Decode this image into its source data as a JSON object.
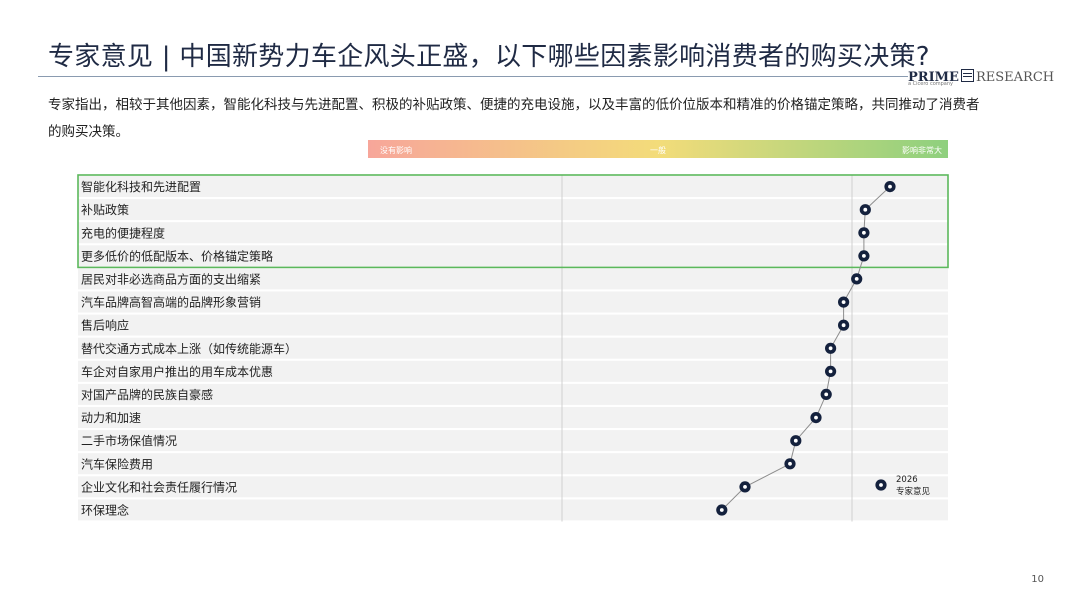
{
  "header": {
    "title": "专家意见 | 中国新势力车企风头正盛，以下哪些因素影响消费者的购买决策?",
    "subtitle": "专家指出，相较于其他因素，智能化科技与先进配置、积极的补贴政策、便捷的充电设施，以及丰富的低价位版本和精准的价格锚定策略，共同推动了消费者的购买决策。",
    "logo_prime": "PRIME",
    "logo_research": "RESEARCH",
    "logo_sub": "a Cicero company"
  },
  "footer": {
    "page_number": "10"
  },
  "colors": {
    "accent_line": "#8a9bb0",
    "dot": "#14213d",
    "highlight_box": "#5cb85c",
    "row_shade": "#f2f2f2",
    "gradient": [
      "#f7a69a",
      "#f3dc7a",
      "#8ed07e"
    ]
  },
  "chart_data": {
    "type": "scatter",
    "title": "",
    "scale_labels": [
      "没有影响",
      "一般",
      "影响非常大"
    ],
    "categories": [
      "智能化科技和先进配置",
      "补贴政策",
      "充电的便捷程度",
      "更多低价的低配版本、价格锚定策略",
      "居民对非必选商品方面的支出缩紧",
      "汽车品牌高智高端的品牌形象营销",
      "售后响应",
      "替代交通方式成本上涨（如传统能源车）",
      "车企对自家用户推出的用车成本优惠",
      "对国产品牌的民族自豪感",
      "动力和加速",
      "二手市场保值情况",
      "汽车保险费用",
      "企业文化和社会责任履行情况",
      "环保理念"
    ],
    "series": [
      {
        "name": "2026 专家意见",
        "values": [
          4.6,
          4.43,
          4.42,
          4.42,
          4.37,
          4.28,
          4.28,
          4.19,
          4.19,
          4.16,
          4.09,
          3.95,
          3.91,
          3.6,
          3.44
        ]
      }
    ],
    "xlim": [
      1,
      5
    ],
    "highlighted_categories": [
      0,
      1,
      2,
      3
    ],
    "legend": {
      "label_year": "2026",
      "label_name": "专家意见",
      "placement": "bottom-right"
    },
    "grid": true
  }
}
